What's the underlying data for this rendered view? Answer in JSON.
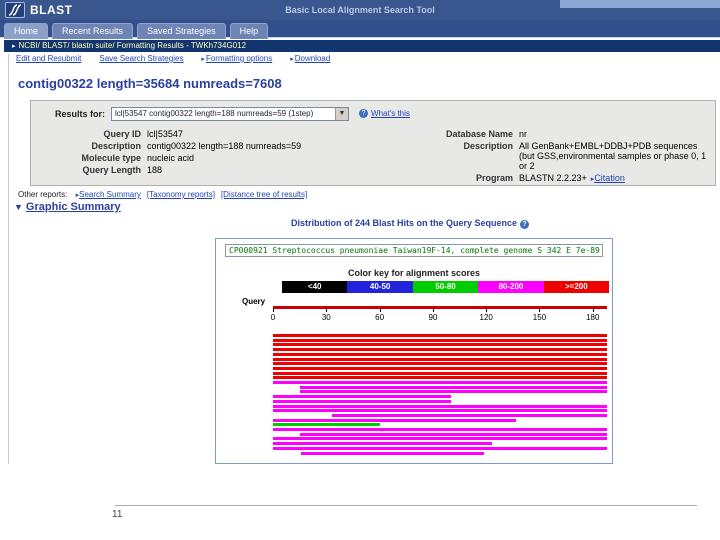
{
  "header": {
    "brand": "BLAST",
    "subtitle": "Basic Local Alignment Search Tool",
    "tabs": [
      "Home",
      "Recent Results",
      "Saved Strategies",
      "Help"
    ]
  },
  "breadcrumb": {
    "text": "NCBI/ BLAST/ blastn suite/ Formatting Results - TWKh734G012"
  },
  "toolbar": {
    "links": [
      {
        "label": "Edit and Resubmit",
        "arrow": false
      },
      {
        "label": "Save Search Strategies",
        "arrow": false
      },
      {
        "label": "Formatting options",
        "arrow": true
      },
      {
        "label": "Download",
        "arrow": true
      }
    ]
  },
  "page_title": "contig00322 length=35684 numreads=7608",
  "results_panel": {
    "results_for_label": "Results for:",
    "selected_query": "lcl|53547 contig00322 length=188 numreads=59 (1step)",
    "whats_this": "What's this",
    "left_fields": [
      {
        "label": "Query ID",
        "value": "lcl|53547"
      },
      {
        "label": "Description",
        "value": "contig00322 length=188 numreads=59"
      },
      {
        "label": "Molecule type",
        "value": "nucleic acid"
      },
      {
        "label": "Query Length",
        "value": "188"
      }
    ],
    "right_fields": [
      {
        "label": "Database Name",
        "value": "nr"
      },
      {
        "label": "Description",
        "value": "All GenBank+EMBL+DDBJ+PDB sequences (but GSS,environmental samples or phase 0, 1 or 2"
      },
      {
        "label": "Program",
        "value": "BLASTN 2.2.23+",
        "link": "Citation"
      }
    ]
  },
  "other_reports": {
    "label": "Other reports:",
    "links": [
      {
        "label": "Search Summary",
        "arrow": true
      },
      {
        "label": "[Taxonomy reports]",
        "arrow": false
      },
      {
        "label": "[Distance tree of results]",
        "arrow": false
      }
    ]
  },
  "graphic_summary": {
    "section_title": "Graphic Summary",
    "distribution_title": "Distribution of 244 Blast Hits on the Query Sequence",
    "selected_hit": "CP000921 Streptococcus pneumoniae Taiwan19F-14, complete genome S 342 E 7e-89",
    "color_key_title": "Color key for alignment scores",
    "color_key": [
      {
        "label": "<40",
        "color": "#000000",
        "text_color": "#ffffff"
      },
      {
        "label": "40-50",
        "color": "#2323dd",
        "text_color": "#ffffff"
      },
      {
        "label": "50-80",
        "color": "#00cc00",
        "text_color": "#ffffff"
      },
      {
        "label": "80-200",
        "color": "#ff00ff",
        "text_color": "#ffffff"
      },
      {
        "label": ">=200",
        "color": "#ee0000",
        "text_color": "#ffffff"
      }
    ],
    "query_axis_label": "Query"
  },
  "chart_data": {
    "type": "bar",
    "title": "Distribution of 244 Blast Hits on the Query Sequence",
    "xlabel": "Query",
    "x_ticks": [
      0,
      30,
      60,
      90,
      120,
      150,
      180
    ],
    "x_range": [
      0,
      188
    ],
    "legend_title": "Color key for alignment scores",
    "score_bands": {
      "<40": "#000000",
      "40-50": "#2323dd",
      "50-80": "#00cc00",
      "80-200": "#ff00ff",
      ">=200": "#ee0000"
    },
    "hits": [
      {
        "start": 0,
        "end": 188,
        "band": ">=200"
      },
      {
        "start": 0,
        "end": 188,
        "band": ">=200"
      },
      {
        "start": 0,
        "end": 188,
        "band": ">=200"
      },
      {
        "start": 0,
        "end": 188,
        "band": ">=200"
      },
      {
        "start": 0,
        "end": 188,
        "band": ">=200"
      },
      {
        "start": 0,
        "end": 188,
        "band": ">=200"
      },
      {
        "start": 0,
        "end": 188,
        "band": ">=200"
      },
      {
        "start": 0,
        "end": 188,
        "band": ">=200"
      },
      {
        "start": 0,
        "end": 188,
        "band": ">=200"
      },
      {
        "start": 0,
        "end": 188,
        "band": ">=200"
      },
      {
        "start": 0,
        "end": 188,
        "band": "80-200"
      },
      {
        "start": 15,
        "end": 188,
        "band": "80-200"
      },
      {
        "start": 15,
        "end": 188,
        "band": "80-200"
      },
      {
        "start": 0,
        "end": 100,
        "band": "80-200"
      },
      {
        "start": 0,
        "end": 100,
        "band": "80-200"
      },
      {
        "start": 0,
        "end": 188,
        "band": "80-200"
      },
      {
        "start": 0,
        "end": 188,
        "band": "80-200"
      },
      {
        "start": 33,
        "end": 188,
        "band": "80-200"
      },
      {
        "start": 0,
        "end": 137,
        "band": "80-200"
      },
      {
        "start": 0,
        "end": 60,
        "band": "50-80"
      },
      {
        "start": 0,
        "end": 188,
        "band": "80-200"
      },
      {
        "start": 15,
        "end": 188,
        "band": "80-200"
      },
      {
        "start": 0,
        "end": 188,
        "band": "80-200"
      },
      {
        "start": 0,
        "end": 123,
        "band": "80-200"
      },
      {
        "start": 0,
        "end": 188,
        "band": "80-200"
      },
      {
        "start": 16,
        "end": 119,
        "band": "80-200"
      }
    ]
  },
  "slide": {
    "page_number": "11"
  }
}
